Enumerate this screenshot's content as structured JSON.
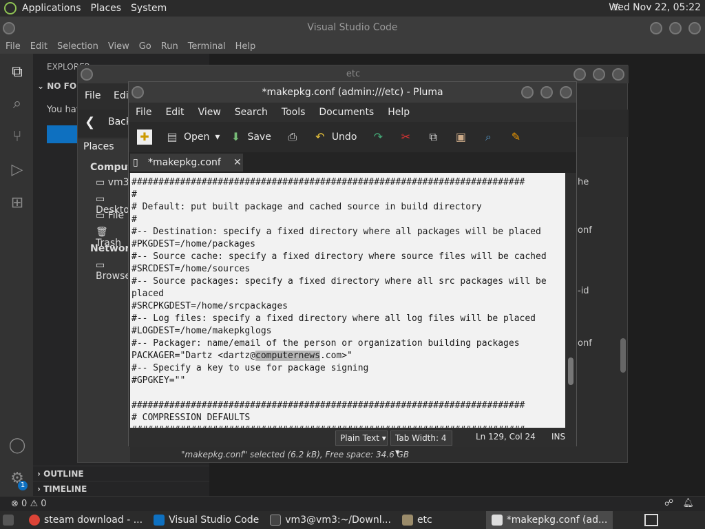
{
  "top_panel": {
    "menus": [
      "Applications",
      "Places",
      "System"
    ],
    "clock": "Wed Nov 22, 05:22"
  },
  "vscode": {
    "title": "Visual Studio Code",
    "menus": [
      "File",
      "Edit",
      "Selection",
      "View",
      "Go",
      "Run",
      "Terminal",
      "Help"
    ],
    "sidebar": {
      "explorer": "EXPLORER",
      "no_folder": "NO FOLDER",
      "you_have": "You have",
      "outline": "OUTLINE",
      "timeline": "TIMELINE"
    },
    "status": {
      "errors": "0",
      "warnings": "0",
      "badge": "1"
    },
    "right_snippets": [
      "he",
      "onf",
      "-id",
      "onf"
    ]
  },
  "filemanager": {
    "title": "etc",
    "menus": [
      "File",
      "Edit"
    ],
    "back": "Back",
    "places_label": "Places",
    "computer_label": "Computer",
    "items": [
      "vm3",
      "Desktop",
      "File",
      "Trash"
    ],
    "network_label": "Network",
    "browse": "Browse",
    "status": "\"makepkg.conf\" selected (6.2 kB), Free space: 34.6 GB"
  },
  "pluma": {
    "title": "*makepkg.conf (admin:///etc) - Pluma",
    "menus": [
      "File",
      "Edit",
      "View",
      "Search",
      "Tools",
      "Documents",
      "Help"
    ],
    "toolbar": {
      "open": "Open",
      "save": "Save",
      "undo": "Undo"
    },
    "tab": "*makepkg.conf",
    "lines": [
      "#########################################################################",
      "#",
      "# Default: put built package and cached source in build directory",
      "#",
      "#-- Destination: specify a fixed directory where all packages will be placed",
      "#PKGDEST=/home/packages",
      "#-- Source cache: specify a fixed directory where source files will be cached",
      "#SRCDEST=/home/sources",
      "#-- Source packages: specify a fixed directory where all src packages will be",
      "placed",
      "#SRCPKGDEST=/home/srcpackages",
      "#-- Log files: specify a fixed directory where all log files will be placed",
      "#LOGDEST=/home/makepkglogs",
      "#-- Packager: name/email of the person or organization building packages",
      "PACKAGER=\"Dartz <dartz@",
      "#-- Specify a key to use for package signing",
      "#GPGKEY=\"\"",
      "",
      "#########################################################################",
      "# COMPRESSION DEFAULTS",
      "#########################################################################"
    ],
    "selected_text": "computernews",
    "after_selected": ".com>\"",
    "status": {
      "lang": "Plain Text",
      "tab_width": "Tab Width:  4",
      "position": "Ln 129, Col 24",
      "mode": "INS"
    }
  },
  "taskbar": {
    "tasks": [
      "steam download - ...",
      "Visual Studio Code",
      "vm3@vm3:~/Downl...",
      "etc",
      "*makepkg.conf (ad..."
    ]
  }
}
